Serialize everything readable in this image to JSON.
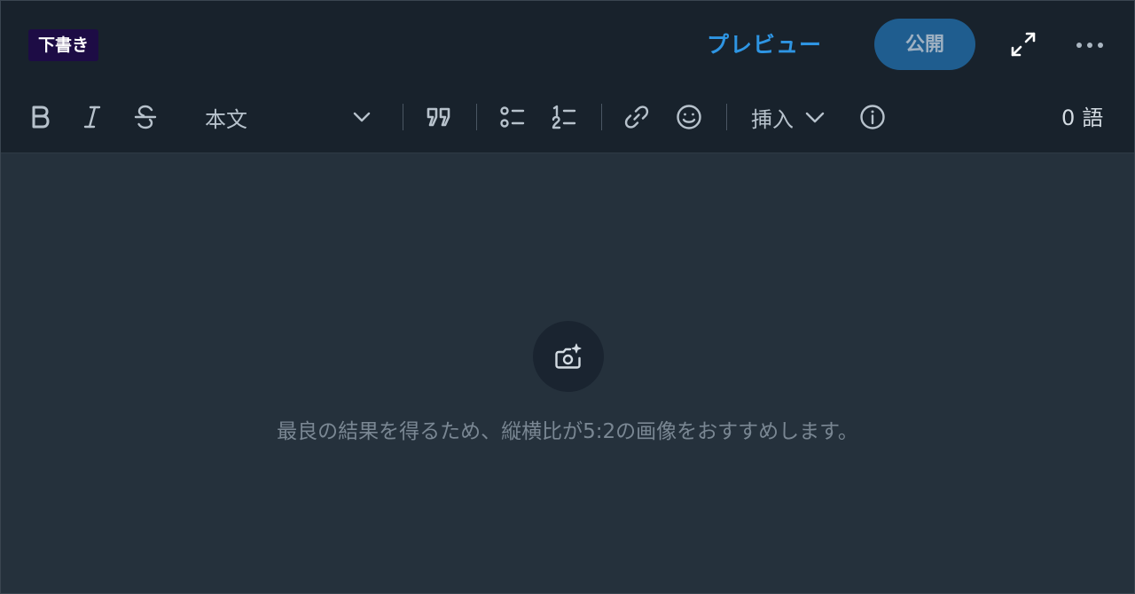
{
  "header": {
    "status_badge": "下書き",
    "preview_label": "プレビュー",
    "publish_label": "公開",
    "expand_icon": "expand-icon",
    "more_icon": "more-options-icon"
  },
  "toolbar": {
    "bold_icon": "bold-icon",
    "italic_icon": "italic-icon",
    "strikethrough_icon": "strikethrough-icon",
    "paragraph_style": "本文",
    "quote_icon": "quote-icon",
    "bullet_list_icon": "bullet-list-icon",
    "numbered_list_icon": "numbered-list-icon",
    "link_icon": "link-icon",
    "emoji_icon": "emoji-icon",
    "insert_label": "挿入",
    "info_icon": "info-icon",
    "word_count": "0",
    "word_unit": "語"
  },
  "editor": {
    "image_upload_icon": "add-image-icon",
    "image_hint": "最良の結果を得るため、縦横比が5:2の画像をおすすめします。"
  },
  "colors": {
    "accent": "#2e95e3",
    "publish_bg": "#1f5d8f",
    "badge_bg": "#1d0c45",
    "topbar_bg": "#18222c",
    "editor_bg": "#25313c"
  }
}
